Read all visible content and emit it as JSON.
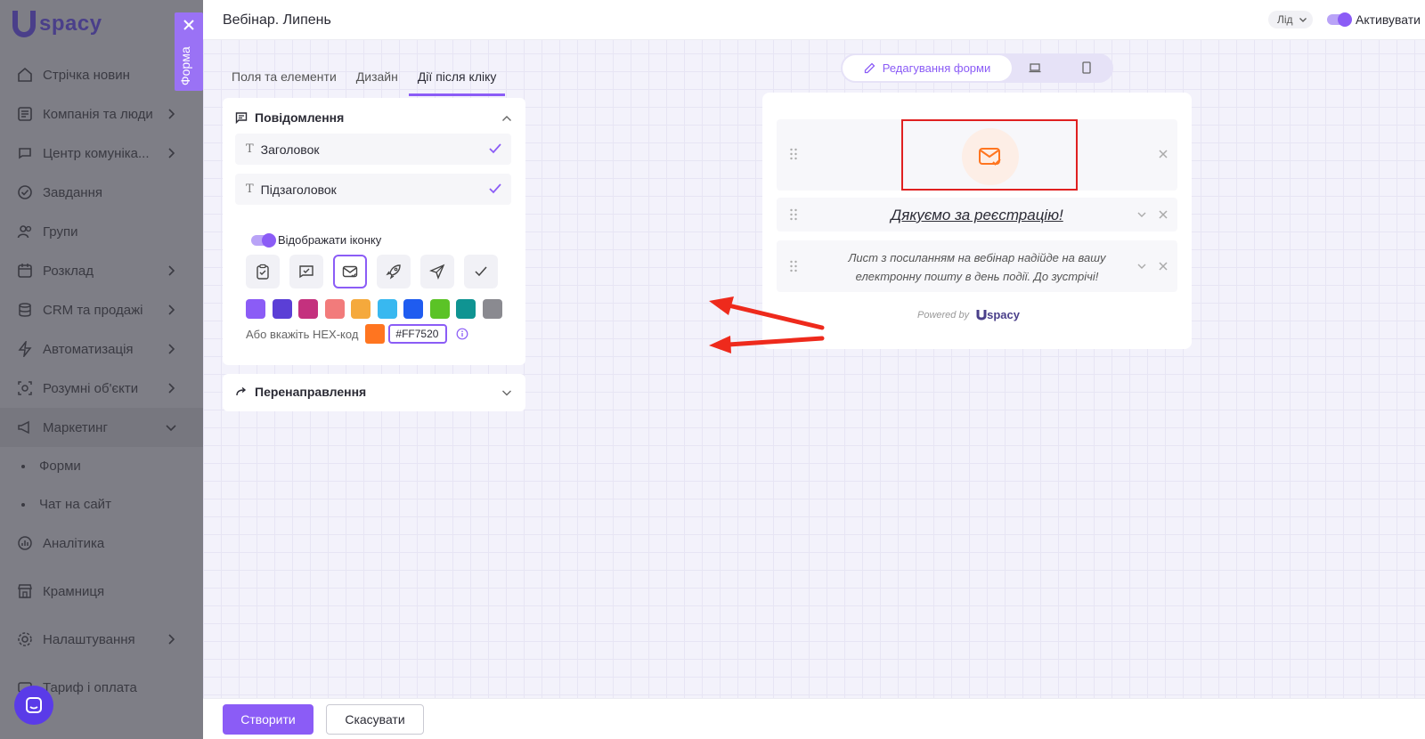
{
  "app": {
    "logo_text": "spacy"
  },
  "sidebar": {
    "items": [
      {
        "label": "Стрічка новин",
        "icon": "news-icon"
      },
      {
        "label": "Компанія та люди",
        "icon": "company-icon",
        "has_children": true
      },
      {
        "label": "Центр комуніка...",
        "icon": "communication-icon",
        "has_children": true
      },
      {
        "label": "Завдання",
        "icon": "tasks-icon"
      },
      {
        "label": "Групи",
        "icon": "groups-icon"
      },
      {
        "label": "Розклад",
        "icon": "calendar-icon",
        "has_children": true
      },
      {
        "label": "CRM та продажі",
        "icon": "crm-icon",
        "has_children": true
      },
      {
        "label": "Автоматизація",
        "icon": "lightning-icon",
        "has_children": true
      },
      {
        "label": "Розумні об'єкти",
        "icon": "smart-objects-icon",
        "has_children": true
      },
      {
        "label": "Маркетинг",
        "icon": "marketing-icon",
        "expanded": true
      },
      {
        "label": "Форми",
        "sub": true
      },
      {
        "label": "Чат на сайт",
        "sub": true
      },
      {
        "label": "Аналітика",
        "icon": "analytics-icon"
      },
      {
        "label": "Крамниця",
        "icon": "store-icon"
      },
      {
        "label": "Налаштування",
        "icon": "gear-icon",
        "has_children": true
      },
      {
        "label": "Тариф і оплата",
        "icon": "tariff-icon"
      }
    ],
    "forma_tab_label": "Форма"
  },
  "header": {
    "title": "Вебінар. Липень",
    "lead_select": "Лід",
    "activate_label": "Активувати"
  },
  "tabs": [
    {
      "label": "Поля та елементи"
    },
    {
      "label": "Дизайн"
    },
    {
      "label": "Дії після кліку",
      "active": true
    }
  ],
  "message_panel": {
    "title": "Повідомлення",
    "fields": [
      {
        "label": "Заголовок",
        "checked": true
      },
      {
        "label": "Підзаголовок",
        "checked": true
      }
    ],
    "show_icon_label": "Відображати іконку",
    "icons": [
      "clipboard-check-icon",
      "chat-check-icon",
      "mail-check-icon",
      "rocket-icon",
      "send-icon",
      "check-icon"
    ],
    "selected_icon": 2,
    "swatches": [
      "#8b5cf6",
      "#5b3fd6",
      "#c4317e",
      "#f27b7b",
      "#f5a93c",
      "#38b8f0",
      "#1f5cf0",
      "#5bc326",
      "#0f9492",
      "#8a8a90"
    ],
    "hex_label": "Або вкажіть HEX-код",
    "hex_value": "#FF7520",
    "hex_color": "#FF7520"
  },
  "redirect_panel": {
    "title": "Перенаправлення"
  },
  "preview": {
    "mode_active_label": "Редагування форми",
    "title": "Дякуємо за реєстрацію!",
    "subtitle": "Лист з посиланням на вебінар надійде на вашу електронну пошту в день події. До зустрічі!",
    "powered_by": "Powered by",
    "powered_logo": "spacy"
  },
  "footer": {
    "create_label": "Створити",
    "cancel_label": "Скасувати"
  },
  "colors": {
    "accent": "#8b5cf6",
    "highlight": "#e02020",
    "annotation": "#ee2a1c"
  }
}
